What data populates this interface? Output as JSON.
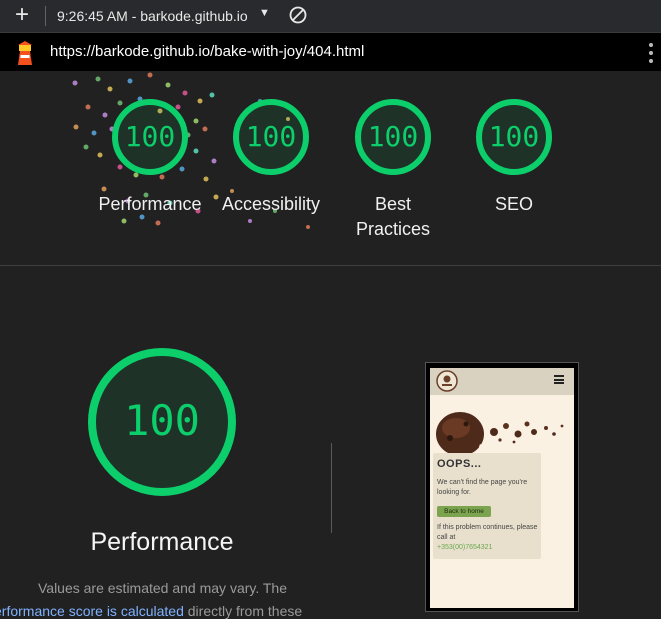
{
  "toolbar": {
    "new_tab_glyph": "+",
    "tab_title": "9:26:45 AM - barkode.github.io",
    "dropdown_glyph": "▼"
  },
  "address_bar": {
    "url": "https://barkode.github.io/bake-with-joy/404.html",
    "menu_glyph": "⋮"
  },
  "scores": [
    {
      "label": "Performance",
      "score": "100"
    },
    {
      "label": "Accessibility",
      "score": "100"
    },
    {
      "label": "Best Practices",
      "score": "100"
    },
    {
      "label": "SEO",
      "score": "100"
    }
  ],
  "performance": {
    "score": "100",
    "title": "Performance",
    "desc_line1": "Values are estimated and may vary. The",
    "desc_link": "erformance score is calculated",
    "desc_rest": " directly from these"
  },
  "preview": {
    "heading": "OOPS...",
    "text": "We can't find the page you're looking for.",
    "button": "Back to home",
    "text2": "If this problem continues, please call at",
    "phone": "+353(00)7654321"
  },
  "colors": {
    "pass_green": "#0cce6b",
    "background": "#212121",
    "link": "#7fb2ff"
  },
  "icons": [
    "plus-icon",
    "no-symbol-icon",
    "lighthouse-icon",
    "kebab-menu-icon",
    "hamburger-icon"
  ]
}
